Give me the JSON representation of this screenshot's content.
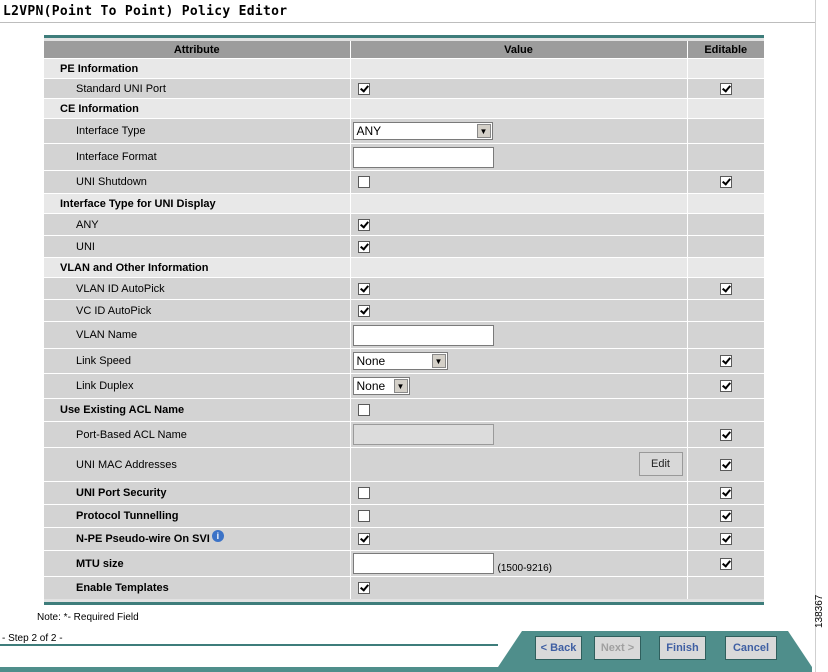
{
  "page": {
    "title": "L2VPN(Point To Point) Policy Editor"
  },
  "table": {
    "headers": {
      "attribute": "Attribute",
      "value": "Value",
      "editable": "Editable"
    },
    "rows": [
      {
        "label": "PE Information",
        "type": "section"
      },
      {
        "label": "Standard UNI Port",
        "value_checkbox": true,
        "editable": true
      },
      {
        "label": "CE Information",
        "type": "section"
      },
      {
        "label": "Interface Type",
        "value_select": "ANY",
        "editable": null
      },
      {
        "label": "Interface Format",
        "value_text": "",
        "editable": null
      },
      {
        "label": "UNI Shutdown",
        "value_checkbox": false,
        "editable": true
      },
      {
        "label": "Interface Type for UNI Display",
        "type": "section"
      },
      {
        "label": "ANY",
        "value_checkbox": true,
        "editable": null
      },
      {
        "label": "UNI",
        "value_checkbox": true,
        "editable": null
      },
      {
        "label": "VLAN and Other Information",
        "type": "section"
      },
      {
        "label": "VLAN ID AutoPick",
        "value_checkbox": true,
        "editable": true
      },
      {
        "label": "VC ID AutoPick",
        "value_checkbox": true,
        "editable": null
      },
      {
        "label": "VLAN Name",
        "value_text": "",
        "editable": null
      },
      {
        "label": "Link Speed",
        "value_select": "None",
        "editable": true
      },
      {
        "label": "Link Duplex",
        "value_select": "None",
        "editable": true
      },
      {
        "label": "Use Existing ACL Name",
        "value_checkbox": false,
        "editable": null
      },
      {
        "label": "Port-Based ACL Name",
        "value_text": "",
        "editable": true
      },
      {
        "label": "UNI MAC Addresses",
        "button": "Edit",
        "editable": true
      },
      {
        "label": "UNI Port Security",
        "value_checkbox": false,
        "editable": true
      },
      {
        "label": "Protocol Tunnelling",
        "value_checkbox": false,
        "editable": true
      },
      {
        "label": "N-PE Pseudo-wire On SVI",
        "value_checkbox": true,
        "editable": true
      },
      {
        "label": "MTU size",
        "value_text": "",
        "hint": "(1500-9216)",
        "editable": true
      },
      {
        "label": "Enable Templates",
        "value_checkbox": true,
        "editable": null
      }
    ]
  },
  "footer": {
    "note": "Note: *- Required Field",
    "step": "- Step 2 of 2 -",
    "buttons": {
      "back": "< Back",
      "next": "Next >",
      "finish": "Finish",
      "cancel": "Cancel"
    },
    "side_id": "138367"
  },
  "icons": {
    "info": "info-icon"
  },
  "colors": {
    "accent": "#3e7d7b",
    "nav_bar": "#4f8e8b",
    "button_text": "#3f5fa3"
  }
}
